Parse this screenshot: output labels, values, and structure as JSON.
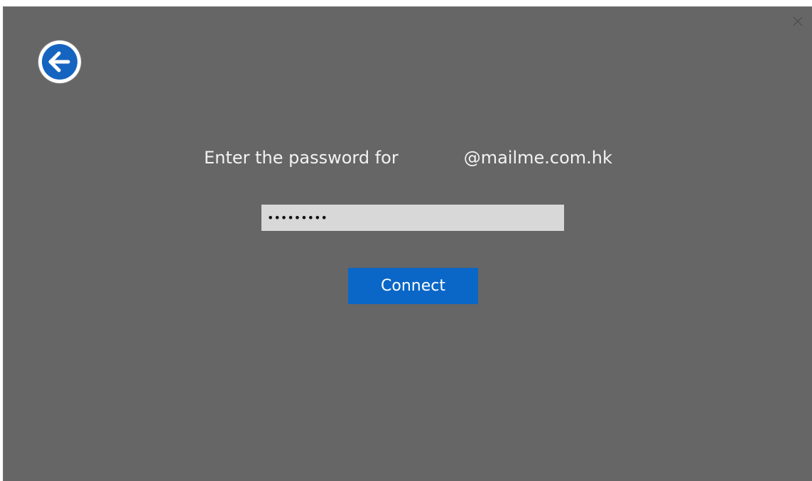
{
  "dialog": {
    "close_icon": "close-icon",
    "back_icon": "back-arrow-icon",
    "prompt_prefix": "Enter the password for",
    "account_domain": "@mailme.com.hk",
    "password_value": "•••••••••",
    "connect_label": "Connect"
  },
  "colors": {
    "background": "#666666",
    "input_background": "#d8d8d8",
    "accent": "#0a67c7",
    "back_arrow": "#1565c0"
  }
}
